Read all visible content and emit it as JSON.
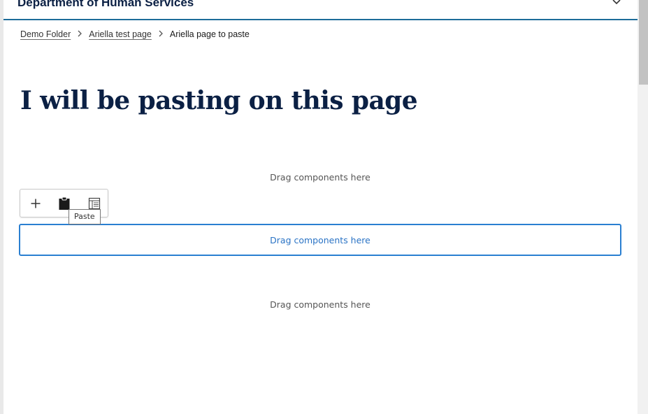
{
  "header": {
    "title": "Department of Human Services",
    "menu_icon": "chevron-down-icon"
  },
  "breadcrumb": {
    "items": [
      "Demo Folder",
      "Ariella test page"
    ],
    "current": "Ariella page to paste",
    "separator_icon": "chevron-right-icon"
  },
  "page": {
    "title": "I will be pasting on this page"
  },
  "dropzones": [
    {
      "label": "Drag components here",
      "state": "default"
    },
    {
      "label": "Drag components here",
      "state": "selected"
    },
    {
      "label": "Drag components here",
      "state": "default"
    }
  ],
  "toolbar": {
    "buttons": [
      {
        "icon": "plus-icon"
      },
      {
        "icon": "clipboard-icon"
      },
      {
        "icon": "layout-icon"
      }
    ],
    "tooltip": "Paste"
  },
  "colors": {
    "title": "#0b2044",
    "header_rule": "#1d6c9a",
    "selected_border": "#2a7fd1",
    "selected_text": "#2a73c5"
  }
}
